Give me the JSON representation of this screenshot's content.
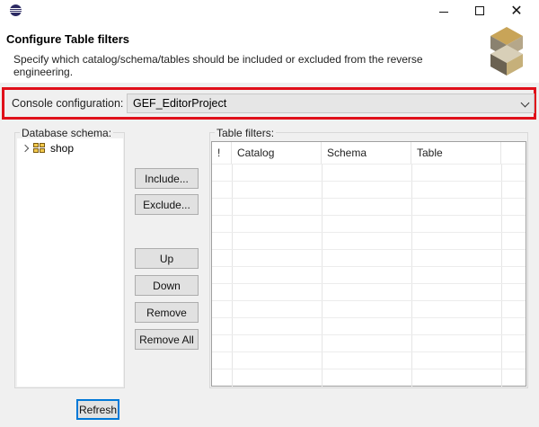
{
  "window": {
    "controls": {
      "minimize_icon": "minimize-icon",
      "maximize_icon": "maximize-icon",
      "close_glyph": "✕"
    }
  },
  "header": {
    "title": "Configure Table filters",
    "description": "Specify which catalog/schema/tables should be included or excluded from the reverse engineering."
  },
  "console": {
    "label": "Console configuration:",
    "selected": "GEF_EditorProject",
    "highlight_color": "#e0101a"
  },
  "schema": {
    "group_label": "Database schema:",
    "items": [
      {
        "label": "shop",
        "icon": "database-icon"
      }
    ],
    "refresh_label": "Refresh"
  },
  "actions": {
    "include": "Include...",
    "exclude": "Exclude...",
    "up": "Up",
    "down": "Down",
    "remove": "Remove",
    "remove_all": "Remove All"
  },
  "filters": {
    "group_label": "Table filters:",
    "columns": [
      "!",
      "Catalog",
      "Schema",
      "Table"
    ],
    "rows": []
  }
}
